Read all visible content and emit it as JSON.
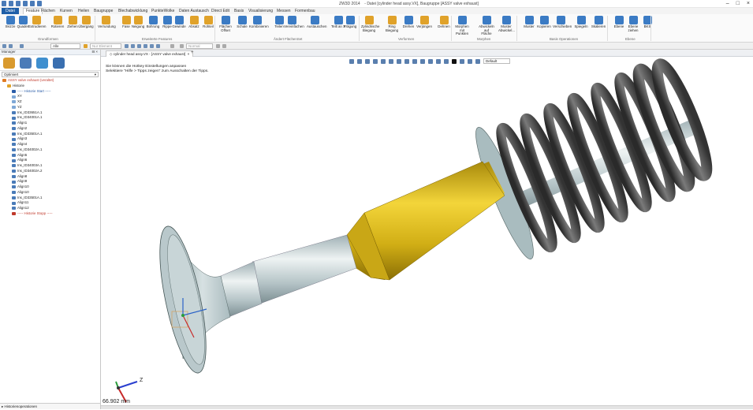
{
  "window": {
    "title": "ZW3D 2014",
    "doc_title": "Datei [cylinder head assy.VX], Baugruppe [ASSY valve exhaust]"
  },
  "menu": [
    "Datei",
    "Feature",
    "Flächen",
    "Kurven",
    "Heilen",
    "Baugruppe",
    "Blechabwicklung",
    "PunkteWolke",
    "Daten Austausch",
    "Direct Edit",
    "Basis",
    "Visualisierung",
    "Messen",
    "Formenbau"
  ],
  "ribbon": {
    "buttons": [
      {
        "label": "Skizze",
        "color": "#3b7bc4"
      },
      {
        "label": "Quader",
        "color": "#3b7bc4"
      },
      {
        "label": "Extrudieren",
        "color": "#e0a22a"
      },
      {
        "label": "Rotieren",
        "color": "#e0a22a"
      },
      {
        "label": "Ziehen",
        "color": "#e0a22a"
      },
      {
        "label": "Übergang",
        "color": "#e0a22a"
      },
      {
        "label": "Verrundung",
        "color": "#e0a22a"
      },
      {
        "label": "Fase",
        "color": "#e0a22a"
      },
      {
        "label": "Neigung",
        "color": "#e0a22a"
      },
      {
        "label": "Bohrung",
        "color": "#3b7bc4"
      },
      {
        "label": "Rippe",
        "color": "#3b7bc4"
      },
      {
        "label": "Gewinde",
        "color": "#3b7bc4"
      },
      {
        "label": "Absatz",
        "color": "#e0a22a"
      },
      {
        "label": "Rohteil",
        "color": "#e0a22a"
      },
      {
        "label": "Flächen Offset",
        "color": "#3b7bc4"
      },
      {
        "label": "Schale",
        "color": "#3b7bc4"
      },
      {
        "label": "Kombinieren",
        "color": "#3b7bc4"
      },
      {
        "label": "Teilen",
        "color": "#3b7bc4"
      },
      {
        "label": "Vereinfachen",
        "color": "#3b7bc4"
      },
      {
        "label": "Austauschen",
        "color": "#3b7bc4"
      },
      {
        "label": "Teilt an X",
        "color": "#3b7bc4"
      },
      {
        "label": "Prägung",
        "color": "#3b7bc4"
      },
      {
        "label": "Zylindrische Biegung",
        "color": "#e0a22a"
      },
      {
        "label": "Ring Biegung",
        "color": "#e0a22a"
      },
      {
        "label": "Drehen",
        "color": "#3b7bc4"
      },
      {
        "label": "Verjüngen",
        "color": "#e0a22a"
      },
      {
        "label": "Dehnen",
        "color": "#e0a22a"
      },
      {
        "label": "Morphen mit Punkten",
        "color": "#3b7bc4"
      },
      {
        "label": "Abwickeln auf Fläche",
        "color": "#3b7bc4"
      },
      {
        "label": "Muster Abwickel...",
        "color": "#3b7bc4"
      },
      {
        "label": "Muster",
        "color": "#3b7bc4"
      },
      {
        "label": "Kopieren",
        "color": "#3b7bc4"
      },
      {
        "label": "Verschieben",
        "color": "#3b7bc4"
      },
      {
        "label": "Spiegeln",
        "color": "#3b7bc4"
      },
      {
        "label": "Skalieren",
        "color": "#3b7bc4"
      },
      {
        "label": "Ebene",
        "color": "#3b7bc4"
      },
      {
        "label": "Ebene ziehen",
        "color": "#3b7bc4"
      },
      {
        "label": "BKS",
        "color": "#3b7bc4"
      }
    ],
    "groups": [
      "Grundformen",
      "Erweiterte Features",
      "Ändert FlächenSet",
      "Verformen",
      "Morphen",
      "Basis Operationen",
      "Ebene"
    ]
  },
  "toolbar2": {
    "filter": "Alle",
    "element": "Nur Element",
    "mode": "Normal"
  },
  "manager": {
    "title": "Manager",
    "option": "Optimiert",
    "tree": [
      {
        "label": "ASSY valve exhaust (veraltet)",
        "color": "#c0392b",
        "indent": 0,
        "icon": "#e07b24"
      },
      {
        "label": "Historie",
        "color": "#222",
        "indent": 1,
        "icon": "#e0a22a"
      },
      {
        "label": "----- Historie Start -----",
        "color": "#2b5da8",
        "indent": 2,
        "icon": "#2b5da8"
      },
      {
        "label": "XY",
        "color": "#222",
        "indent": 2,
        "icon": "#7fa8d6"
      },
      {
        "label": "XZ",
        "color": "#222",
        "indent": 2,
        "icon": "#7fa8d6"
      },
      {
        "label": "YZ",
        "color": "#222",
        "indent": 2,
        "icon": "#7fa8d6"
      },
      {
        "label": "Ins_ID33651A.1",
        "color": "#222",
        "indent": 2,
        "icon": "#4a7bb8"
      },
      {
        "label": "Ins_ID34001A.1",
        "color": "#222",
        "indent": 2,
        "icon": "#4a7bb8"
      },
      {
        "label": "Align1",
        "color": "#222",
        "indent": 2,
        "icon": "#4a7bb8"
      },
      {
        "label": "Align2",
        "color": "#222",
        "indent": 2,
        "icon": "#4a7bb8"
      },
      {
        "label": "Ins_ID33501A.1",
        "color": "#222",
        "indent": 2,
        "icon": "#4a7bb8"
      },
      {
        "label": "Align3",
        "color": "#222",
        "indent": 2,
        "icon": "#4a7bb8"
      },
      {
        "label": "Align4",
        "color": "#222",
        "indent": 2,
        "icon": "#4a7bb8"
      },
      {
        "label": "Ins_ID34002A.1",
        "color": "#222",
        "indent": 2,
        "icon": "#4a7bb8"
      },
      {
        "label": "Align5",
        "color": "#222",
        "indent": 2,
        "icon": "#4a7bb8"
      },
      {
        "label": "Align6",
        "color": "#222",
        "indent": 2,
        "icon": "#4a7bb8"
      },
      {
        "label": "Ins_ID34003A.1",
        "color": "#222",
        "indent": 2,
        "icon": "#4a7bb8"
      },
      {
        "label": "Ins_ID34002A.2",
        "color": "#222",
        "indent": 2,
        "icon": "#4a7bb8"
      },
      {
        "label": "Align8",
        "color": "#222",
        "indent": 2,
        "icon": "#4a7bb8"
      },
      {
        "label": "Align9",
        "color": "#222",
        "indent": 2,
        "icon": "#4a7bb8"
      },
      {
        "label": "Align10",
        "color": "#222",
        "indent": 2,
        "icon": "#4a7bb8"
      },
      {
        "label": "Align10",
        "color": "#222",
        "indent": 2,
        "icon": "#4a7bb8"
      },
      {
        "label": "Ins_ID33501A.1",
        "color": "#222",
        "indent": 2,
        "icon": "#4a7bb8"
      },
      {
        "label": "Align11",
        "color": "#222",
        "indent": 2,
        "icon": "#4a7bb8"
      },
      {
        "label": "Align12",
        "color": "#222",
        "indent": 2,
        "icon": "#4a7bb8"
      },
      {
        "label": "----- Historie Stopp -----",
        "color": "#c0392b",
        "indent": 2,
        "icon": "#c0392b"
      }
    ],
    "bottom": "Historienoperationen"
  },
  "doc_tab": {
    "label": "cylinder head assy.VX - [ASSY valve exhaust]"
  },
  "view": {
    "style": "Default"
  },
  "hints": [
    "Sie können die Hotkey Einstellungen anpassen",
    "Selektiere \"Hilfe > Tipps zeigen\" zum Ausschalten der Tipps."
  ],
  "axis": {
    "z": "Z",
    "x": "X",
    "y": "Y"
  },
  "readout": "66.902 mm"
}
